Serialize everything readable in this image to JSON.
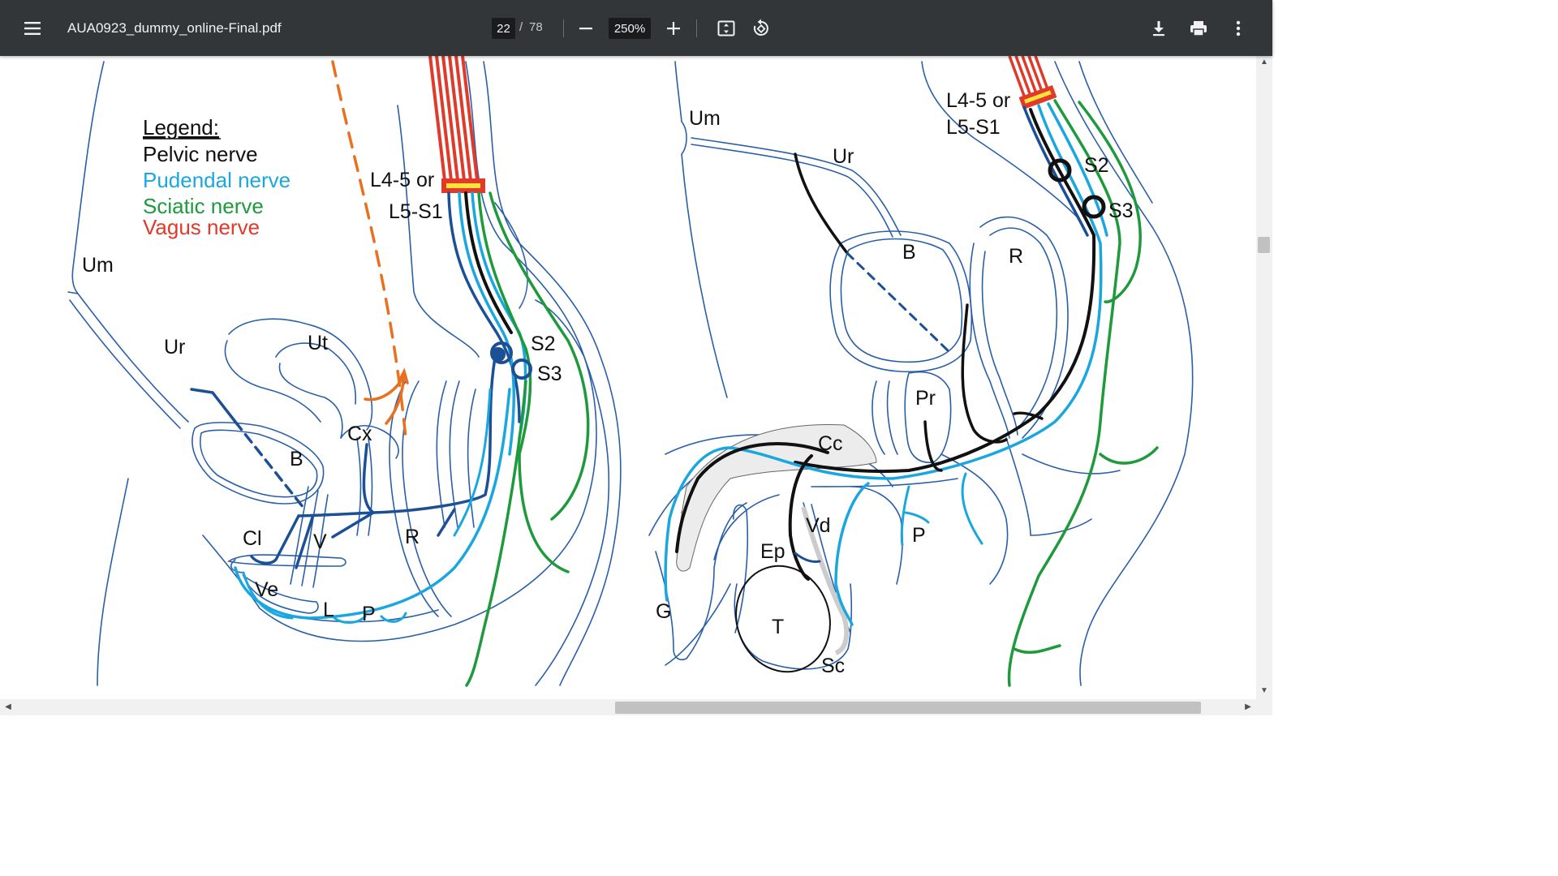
{
  "toolbar": {
    "menu_icon": "hamburger-menu-icon",
    "title": "AUA0923_dummy_online-Final.pdf",
    "page_current": "22",
    "page_separator": "/",
    "page_total": "78",
    "zoom_out_icon": "minus-icon",
    "zoom": "250%",
    "zoom_in_icon": "plus-icon",
    "fit_icon": "fit-to-page-icon",
    "rotate_icon": "rotate-icon",
    "download_icon": "download-icon",
    "print_icon": "print-icon",
    "more_icon": "more-vertical-icon"
  },
  "figure": {
    "legend": {
      "heading": "Legend:",
      "items": [
        {
          "label": "Pelvic nerve",
          "color": "#111111"
        },
        {
          "label": "Pudendal nerve",
          "color": "#1aa7e0"
        },
        {
          "label": "Sciatic nerve",
          "color": "#1e9a3c"
        },
        {
          "label": "Vagus nerve",
          "color": "#e03a2a"
        }
      ]
    },
    "female_labels": {
      "um": "Um",
      "ur": "Ur",
      "ut": "Ut",
      "b": "B",
      "cx": "Cx",
      "cl": "Cl",
      "v": "V",
      "ve": "Ve",
      "l": "L",
      "p": "P",
      "r": "R",
      "s2": "S2",
      "s3": "S3",
      "level_line1": "L4-5 or",
      "level_line2": "L5-S1"
    },
    "male_labels": {
      "um": "Um",
      "ur": "Ur",
      "b": "B",
      "r": "R",
      "pr": "Pr",
      "cc": "Cc",
      "vd": "Vd",
      "ep": "Ep",
      "p": "P",
      "g": "G",
      "t": "T",
      "sc": "Sc",
      "s2": "S2",
      "s3": "S3",
      "level_line1": "L4-5 or",
      "level_line2": "L5-S1"
    }
  },
  "colors": {
    "toolbar_bg": "#323639",
    "anatomy_outline": "#2a5fa8",
    "pelvic_nerve": "#111111",
    "pudendal_nerve": "#1aa7e0",
    "sciatic_nerve": "#1e9a3c",
    "vagus_nerve": "#e03a2a",
    "dark_blue_nerve": "#1b4f96",
    "orange_dashed": "#e8701e"
  }
}
